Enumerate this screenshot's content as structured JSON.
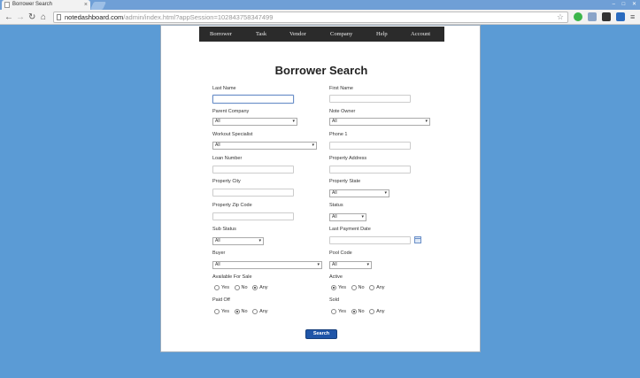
{
  "browser": {
    "tab_title": "Borrower Search",
    "url_host": "notedashboard.com",
    "url_path": "/admin/index.html?appSession=102843758347499"
  },
  "nav": [
    "Borrower",
    "Task",
    "Vendor",
    "Company",
    "Help",
    "Account"
  ],
  "page": {
    "title": "Borrower Search",
    "fields": {
      "last_name": {
        "label": "Last Name",
        "value": ""
      },
      "first_name": {
        "label": "First Name",
        "value": ""
      },
      "parent_company": {
        "label": "Parent Company",
        "value": "All"
      },
      "note_owner": {
        "label": "Note Owner",
        "value": "All"
      },
      "workout_specialist": {
        "label": "Workout Specialist",
        "value": "All"
      },
      "phone1": {
        "label": "Phone 1",
        "value": ""
      },
      "loan_number": {
        "label": "Loan Number",
        "value": ""
      },
      "property_address": {
        "label": "Property Address",
        "value": ""
      },
      "property_city": {
        "label": "Property City",
        "value": ""
      },
      "property_state": {
        "label": "Property State",
        "value": "All"
      },
      "property_zip": {
        "label": "Property Zip Code",
        "value": ""
      },
      "status": {
        "label": "Status",
        "value": "All"
      },
      "sub_status": {
        "label": "Sub Status",
        "value": "All"
      },
      "last_payment_date": {
        "label": "Last Payment Date",
        "value": ""
      },
      "buyer": {
        "label": "Buyer",
        "value": "All"
      },
      "pool_code": {
        "label": "Pool Code",
        "value": "All"
      }
    },
    "radios": {
      "available_for_sale": {
        "label": "Available For Sale",
        "options": [
          "Yes",
          "No",
          "Any"
        ],
        "selected": "Any"
      },
      "active": {
        "label": "Active",
        "options": [
          "Yes",
          "No",
          "Any"
        ],
        "selected": "Yes"
      },
      "paid_off": {
        "label": "Paid Off",
        "options": [
          "Yes",
          "No",
          "Any"
        ],
        "selected": "No"
      },
      "sold": {
        "label": "Sold",
        "options": [
          "Yes",
          "No",
          "Any"
        ],
        "selected": "No"
      }
    },
    "search_label": "Search"
  }
}
